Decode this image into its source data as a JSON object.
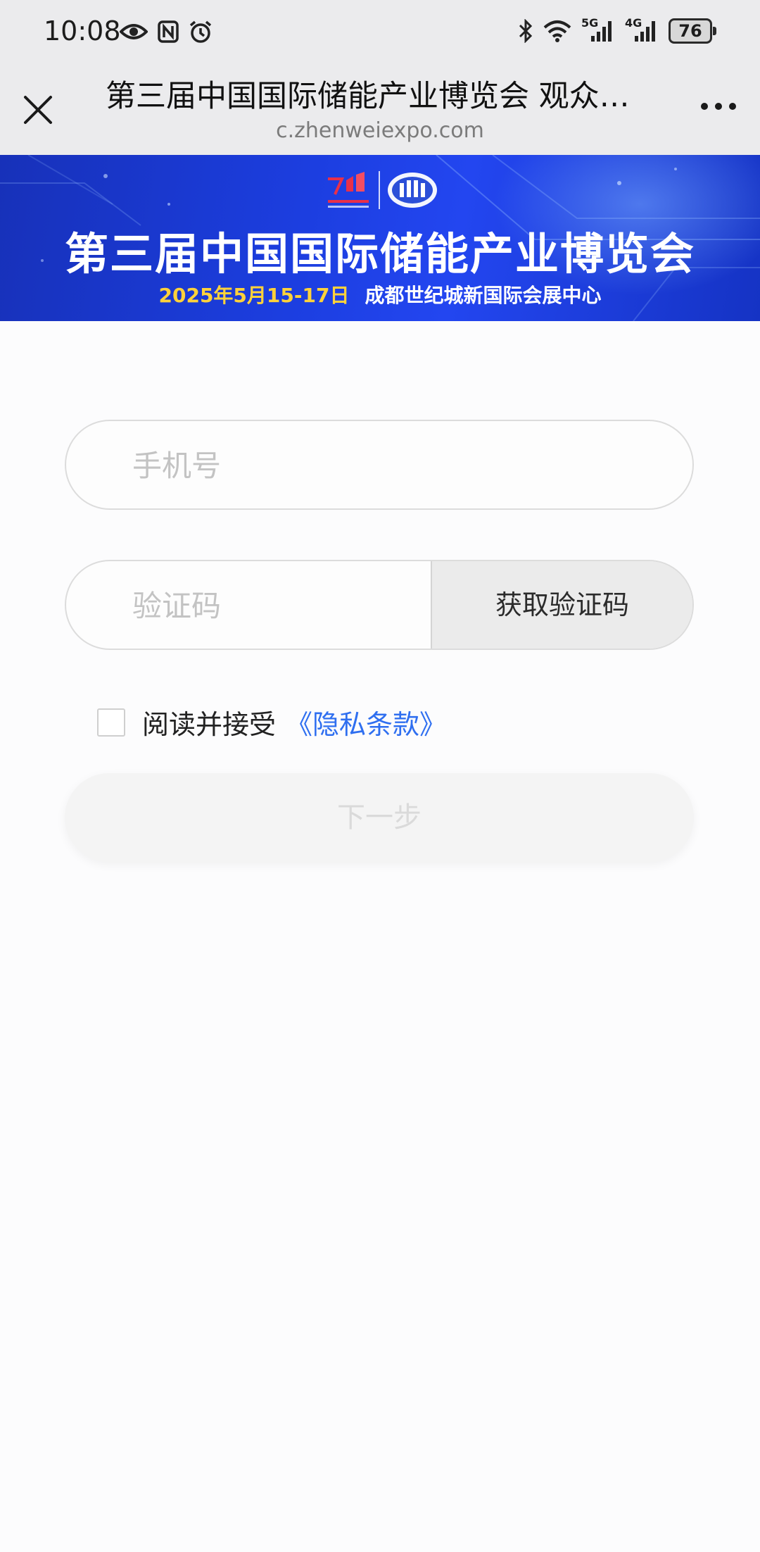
{
  "status_bar": {
    "time": "10:08",
    "battery": "76",
    "signal_1_label": "5G",
    "signal_2_label": "4G"
  },
  "header": {
    "title": "第三届中国国际储能产业博览会 观众预登记",
    "url": "c.zhenweiexpo.com"
  },
  "banner": {
    "title": "第三届中国国际储能产业博览会",
    "date": "2025年5月15-17日",
    "venue": "成都世纪城新国际会展中心"
  },
  "form": {
    "phone_placeholder": "手机号",
    "code_placeholder": "验证码",
    "get_code_label": "获取验证码",
    "agree_text": "阅读并接受",
    "privacy_link": "《隐私条款》",
    "next_label": "下一步",
    "agree_checked": false
  },
  "colors": {
    "banner_blue": "#1c3ee0",
    "date_yellow": "#ffd23a",
    "link_blue": "#2f6ff0",
    "header_bg": "#ebebed"
  }
}
